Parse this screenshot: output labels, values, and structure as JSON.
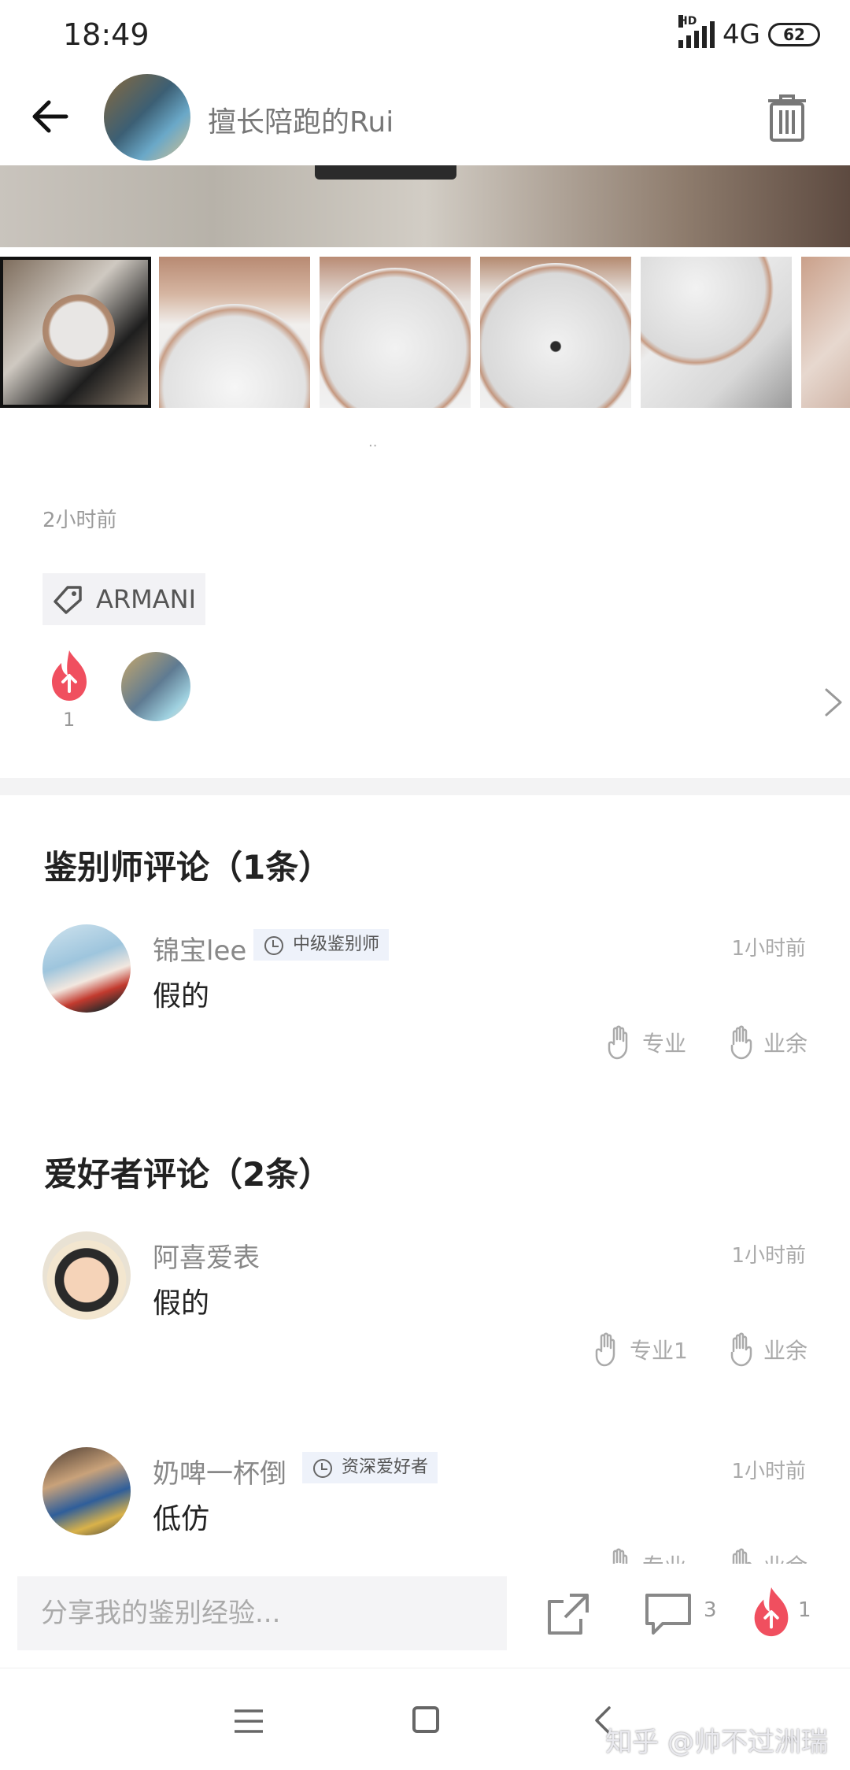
{
  "status_bar": {
    "time": "18:49",
    "network": "4G",
    "hd": "HD",
    "battery": "62"
  },
  "header": {
    "username": "擅长陪跑的Rui"
  },
  "post": {
    "time_ago": "2小时前",
    "brand_tag": "ARMANI",
    "like_count": "1"
  },
  "expert_section": {
    "title": "鉴别师评论（1条）",
    "comments": [
      {
        "name": "锦宝lee",
        "badge": "中级鉴别师",
        "time": "1小时前",
        "text": "假的",
        "pro_label": "专业",
        "amateur_label": "业余"
      }
    ]
  },
  "fan_section": {
    "title": "爱好者评论（2条）",
    "comments": [
      {
        "name": "阿喜爱表",
        "time": "1小时前",
        "text": "假的",
        "pro_label": "专业1",
        "amateur_label": "业余"
      },
      {
        "name": "奶啤一杯倒",
        "badge": "资深爱好者",
        "time": "1小时前",
        "text": "低仿",
        "pro_label": "专业",
        "amateur_label": "业余"
      }
    ]
  },
  "bottom_bar": {
    "input_placeholder": "分享我的鉴别经验...",
    "comment_count": "3",
    "fire_count": "1"
  },
  "watermark": "知乎 @帅不过洲瑞",
  "colors": {
    "fire": "#f04f5f",
    "badge_bg": "#eef2fa",
    "muted": "#aaaaaa"
  }
}
